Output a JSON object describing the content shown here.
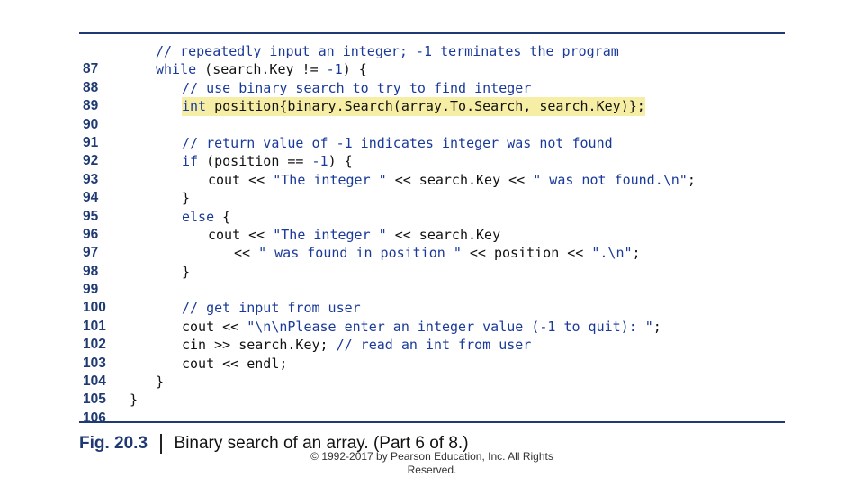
{
  "code_lines": [
    {
      "num": "87",
      "text": "// repeatedly input an integer; -1 terminates the program"
    },
    {
      "num": "88",
      "text": "while (search.Key != -1) {"
    },
    {
      "num": "89",
      "text": "// use binary search to try to find integer"
    },
    {
      "num": "90",
      "text": "int position{binary.Search(array.To.Search, search.Key)};"
    },
    {
      "num": "91",
      "text": ""
    },
    {
      "num": "92",
      "text": "// return value of -1 indicates integer was not found"
    },
    {
      "num": "93",
      "text": "if (position == -1) {"
    },
    {
      "num": "94",
      "text": "cout << \"The integer \" << search.Key << \" was not found.\\n\";"
    },
    {
      "num": "95",
      "text": "}"
    },
    {
      "num": "96",
      "text": "else {"
    },
    {
      "num": "97",
      "text": "cout << \"The integer \" << search.Key"
    },
    {
      "num": "98",
      "text": "<< \" was found in position \" << position << \".\\n\";"
    },
    {
      "num": "99",
      "text": "}"
    },
    {
      "num": "100",
      "text": ""
    },
    {
      "num": "101",
      "text": "// get input from user"
    },
    {
      "num": "102",
      "text": "cout << \"\\n\\nPlease enter an integer value (-1 to quit): \";"
    },
    {
      "num": "103",
      "text": "cin >> search.Key; // read an int from user"
    },
    {
      "num": "104",
      "text": "cout << endl;"
    },
    {
      "num": "105",
      "text": "}"
    },
    {
      "num": "106",
      "text": "}"
    }
  ],
  "caption": {
    "label": "Fig. 20.3",
    "text": "Binary search of an array. (Part 6 of 8.)"
  },
  "footer": {
    "line1": "© 1992-2017 by Pearson Education, Inc. All Rights",
    "line2": "Reserved."
  },
  "colors": {
    "code_keyword": "#1a3a9a",
    "rule": "#1f3a73",
    "highlight": "#f7eea6"
  }
}
